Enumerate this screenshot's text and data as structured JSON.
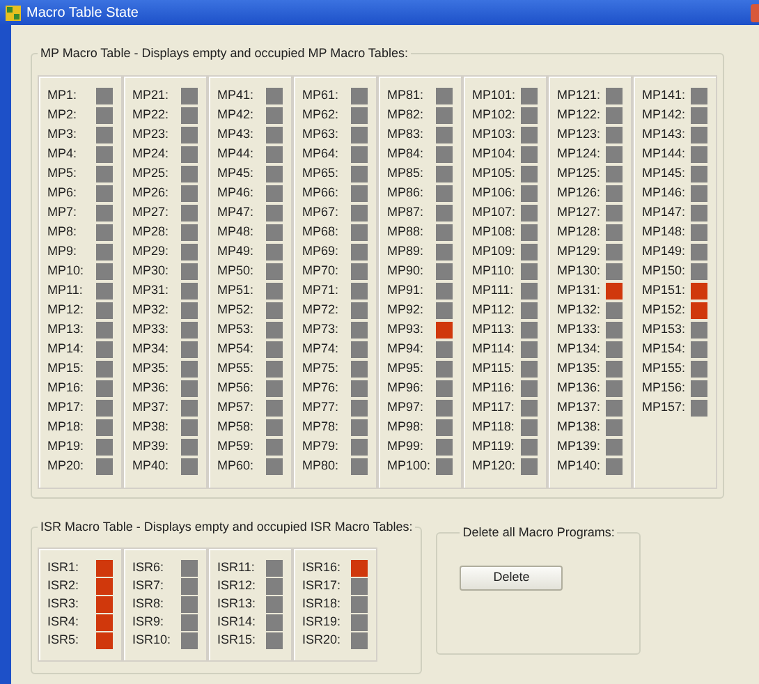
{
  "window": {
    "title": "Macro Table State"
  },
  "mp_table": {
    "title": "MP Macro Table - Displays empty and occupied MP Macro Tables:",
    "columns": [
      {
        "slots": [
          {
            "label": "MP1:",
            "occupied": false
          },
          {
            "label": "MP2:",
            "occupied": false
          },
          {
            "label": "MP3:",
            "occupied": false
          },
          {
            "label": "MP4:",
            "occupied": false
          },
          {
            "label": "MP5:",
            "occupied": false
          },
          {
            "label": "MP6:",
            "occupied": false
          },
          {
            "label": "MP7:",
            "occupied": false
          },
          {
            "label": "MP8:",
            "occupied": false
          },
          {
            "label": "MP9:",
            "occupied": false
          },
          {
            "label": "MP10:",
            "occupied": false
          },
          {
            "label": "MP11:",
            "occupied": false
          },
          {
            "label": "MP12:",
            "occupied": false
          },
          {
            "label": "MP13:",
            "occupied": false
          },
          {
            "label": "MP14:",
            "occupied": false
          },
          {
            "label": "MP15:",
            "occupied": false
          },
          {
            "label": "MP16:",
            "occupied": false
          },
          {
            "label": "MP17:",
            "occupied": false
          },
          {
            "label": "MP18:",
            "occupied": false
          },
          {
            "label": "MP19:",
            "occupied": false
          },
          {
            "label": "MP20:",
            "occupied": false
          }
        ]
      },
      {
        "slots": [
          {
            "label": "MP21:",
            "occupied": false
          },
          {
            "label": "MP22:",
            "occupied": false
          },
          {
            "label": "MP23:",
            "occupied": false
          },
          {
            "label": "MP24:",
            "occupied": false
          },
          {
            "label": "MP25:",
            "occupied": false
          },
          {
            "label": "MP26:",
            "occupied": false
          },
          {
            "label": "MP27:",
            "occupied": false
          },
          {
            "label": "MP28:",
            "occupied": false
          },
          {
            "label": "MP29:",
            "occupied": false
          },
          {
            "label": "MP30:",
            "occupied": false
          },
          {
            "label": "MP31:",
            "occupied": false
          },
          {
            "label": "MP32:",
            "occupied": false
          },
          {
            "label": "MP33:",
            "occupied": false
          },
          {
            "label": "MP34:",
            "occupied": false
          },
          {
            "label": "MP35:",
            "occupied": false
          },
          {
            "label": "MP36:",
            "occupied": false
          },
          {
            "label": "MP37:",
            "occupied": false
          },
          {
            "label": "MP38:",
            "occupied": false
          },
          {
            "label": "MP39:",
            "occupied": false
          },
          {
            "label": "MP40:",
            "occupied": false
          }
        ]
      },
      {
        "slots": [
          {
            "label": "MP41:",
            "occupied": false
          },
          {
            "label": "MP42:",
            "occupied": false
          },
          {
            "label": "MP43:",
            "occupied": false
          },
          {
            "label": "MP44:",
            "occupied": false
          },
          {
            "label": "MP45:",
            "occupied": false
          },
          {
            "label": "MP46:",
            "occupied": false
          },
          {
            "label": "MP47:",
            "occupied": false
          },
          {
            "label": "MP48:",
            "occupied": false
          },
          {
            "label": "MP49:",
            "occupied": false
          },
          {
            "label": "MP50:",
            "occupied": false
          },
          {
            "label": "MP51:",
            "occupied": false
          },
          {
            "label": "MP52:",
            "occupied": false
          },
          {
            "label": "MP53:",
            "occupied": false
          },
          {
            "label": "MP54:",
            "occupied": false
          },
          {
            "label": "MP55:",
            "occupied": false
          },
          {
            "label": "MP56:",
            "occupied": false
          },
          {
            "label": "MP57:",
            "occupied": false
          },
          {
            "label": "MP58:",
            "occupied": false
          },
          {
            "label": "MP59:",
            "occupied": false
          },
          {
            "label": "MP60:",
            "occupied": false
          }
        ]
      },
      {
        "slots": [
          {
            "label": "MP61:",
            "occupied": false
          },
          {
            "label": "MP62:",
            "occupied": false
          },
          {
            "label": "MP63:",
            "occupied": false
          },
          {
            "label": "MP64:",
            "occupied": false
          },
          {
            "label": "MP65:",
            "occupied": false
          },
          {
            "label": "MP66:",
            "occupied": false
          },
          {
            "label": "MP67:",
            "occupied": false
          },
          {
            "label": "MP68:",
            "occupied": false
          },
          {
            "label": "MP69:",
            "occupied": false
          },
          {
            "label": "MP70:",
            "occupied": false
          },
          {
            "label": "MP71:",
            "occupied": false
          },
          {
            "label": "MP72:",
            "occupied": false
          },
          {
            "label": "MP73:",
            "occupied": false
          },
          {
            "label": "MP74:",
            "occupied": false
          },
          {
            "label": "MP75:",
            "occupied": false
          },
          {
            "label": "MP76:",
            "occupied": false
          },
          {
            "label": "MP77:",
            "occupied": false
          },
          {
            "label": "MP78:",
            "occupied": false
          },
          {
            "label": "MP79:",
            "occupied": false
          },
          {
            "label": "MP80:",
            "occupied": false
          }
        ]
      },
      {
        "slots": [
          {
            "label": "MP81:",
            "occupied": false
          },
          {
            "label": "MP82:",
            "occupied": false
          },
          {
            "label": "MP83:",
            "occupied": false
          },
          {
            "label": "MP84:",
            "occupied": false
          },
          {
            "label": "MP85:",
            "occupied": false
          },
          {
            "label": "MP86:",
            "occupied": false
          },
          {
            "label": "MP87:",
            "occupied": false
          },
          {
            "label": "MP88:",
            "occupied": false
          },
          {
            "label": "MP89:",
            "occupied": false
          },
          {
            "label": "MP90:",
            "occupied": false
          },
          {
            "label": "MP91:",
            "occupied": false
          },
          {
            "label": "MP92:",
            "occupied": false
          },
          {
            "label": "MP93:",
            "occupied": true
          },
          {
            "label": "MP94:",
            "occupied": false
          },
          {
            "label": "MP95:",
            "occupied": false
          },
          {
            "label": "MP96:",
            "occupied": false
          },
          {
            "label": "MP97:",
            "occupied": false
          },
          {
            "label": "MP98:",
            "occupied": false
          },
          {
            "label": "MP99:",
            "occupied": false
          },
          {
            "label": "MP100:",
            "occupied": false
          }
        ]
      },
      {
        "slots": [
          {
            "label": "MP101:",
            "occupied": false
          },
          {
            "label": "MP102:",
            "occupied": false
          },
          {
            "label": "MP103:",
            "occupied": false
          },
          {
            "label": "MP104:",
            "occupied": false
          },
          {
            "label": "MP105:",
            "occupied": false
          },
          {
            "label": "MP106:",
            "occupied": false
          },
          {
            "label": "MP107:",
            "occupied": false
          },
          {
            "label": "MP108:",
            "occupied": false
          },
          {
            "label": "MP109:",
            "occupied": false
          },
          {
            "label": "MP110:",
            "occupied": false
          },
          {
            "label": "MP111:",
            "occupied": false
          },
          {
            "label": "MP112:",
            "occupied": false
          },
          {
            "label": "MP113:",
            "occupied": false
          },
          {
            "label": "MP114:",
            "occupied": false
          },
          {
            "label": "MP115:",
            "occupied": false
          },
          {
            "label": "MP116:",
            "occupied": false
          },
          {
            "label": "MP117:",
            "occupied": false
          },
          {
            "label": "MP118:",
            "occupied": false
          },
          {
            "label": "MP119:",
            "occupied": false
          },
          {
            "label": "MP120:",
            "occupied": false
          }
        ]
      },
      {
        "slots": [
          {
            "label": "MP121:",
            "occupied": false
          },
          {
            "label": "MP122:",
            "occupied": false
          },
          {
            "label": "MP123:",
            "occupied": false
          },
          {
            "label": "MP124:",
            "occupied": false
          },
          {
            "label": "MP125:",
            "occupied": false
          },
          {
            "label": "MP126:",
            "occupied": false
          },
          {
            "label": "MP127:",
            "occupied": false
          },
          {
            "label": "MP128:",
            "occupied": false
          },
          {
            "label": "MP129:",
            "occupied": false
          },
          {
            "label": "MP130:",
            "occupied": false
          },
          {
            "label": "MP131:",
            "occupied": true
          },
          {
            "label": "MP132:",
            "occupied": false
          },
          {
            "label": "MP133:",
            "occupied": false
          },
          {
            "label": "MP134:",
            "occupied": false
          },
          {
            "label": "MP135:",
            "occupied": false
          },
          {
            "label": "MP136:",
            "occupied": false
          },
          {
            "label": "MP137:",
            "occupied": false
          },
          {
            "label": "MP138:",
            "occupied": false
          },
          {
            "label": "MP139:",
            "occupied": false
          },
          {
            "label": "MP140:",
            "occupied": false
          }
        ]
      },
      {
        "slots": [
          {
            "label": "MP141:",
            "occupied": false
          },
          {
            "label": "MP142:",
            "occupied": false
          },
          {
            "label": "MP143:",
            "occupied": false
          },
          {
            "label": "MP144:",
            "occupied": false
          },
          {
            "label": "MP145:",
            "occupied": false
          },
          {
            "label": "MP146:",
            "occupied": false
          },
          {
            "label": "MP147:",
            "occupied": false
          },
          {
            "label": "MP148:",
            "occupied": false
          },
          {
            "label": "MP149:",
            "occupied": false
          },
          {
            "label": "MP150:",
            "occupied": false
          },
          {
            "label": "MP151:",
            "occupied": true
          },
          {
            "label": "MP152:",
            "occupied": true
          },
          {
            "label": "MP153:",
            "occupied": false
          },
          {
            "label": "MP154:",
            "occupied": false
          },
          {
            "label": "MP155:",
            "occupied": false
          },
          {
            "label": "MP156:",
            "occupied": false
          },
          {
            "label": "MP157:",
            "occupied": false
          }
        ]
      }
    ]
  },
  "isr_table": {
    "title": "ISR Macro Table - Displays empty and occupied ISR Macro Tables:",
    "columns": [
      {
        "slots": [
          {
            "label": "ISR1:",
            "occupied": true
          },
          {
            "label": "ISR2:",
            "occupied": true
          },
          {
            "label": "ISR3:",
            "occupied": true
          },
          {
            "label": "ISR4:",
            "occupied": true
          },
          {
            "label": "ISR5:",
            "occupied": true
          }
        ]
      },
      {
        "slots": [
          {
            "label": "ISR6:",
            "occupied": false
          },
          {
            "label": "ISR7:",
            "occupied": false
          },
          {
            "label": "ISR8:",
            "occupied": false
          },
          {
            "label": "ISR9:",
            "occupied": false
          },
          {
            "label": "ISR10:",
            "occupied": false
          }
        ]
      },
      {
        "slots": [
          {
            "label": "ISR11:",
            "occupied": false
          },
          {
            "label": "ISR12:",
            "occupied": false
          },
          {
            "label": "ISR13:",
            "occupied": false
          },
          {
            "label": "ISR14:",
            "occupied": false
          },
          {
            "label": "ISR15:",
            "occupied": false
          }
        ]
      },
      {
        "slots": [
          {
            "label": "ISR16:",
            "occupied": true
          },
          {
            "label": "ISR17:",
            "occupied": false
          },
          {
            "label": "ISR18:",
            "occupied": false
          },
          {
            "label": "ISR19:",
            "occupied": false
          },
          {
            "label": "ISR20:",
            "occupied": false
          }
        ]
      }
    ]
  },
  "delete_group": {
    "title": "Delete all Macro Programs:",
    "button": "Delete"
  }
}
